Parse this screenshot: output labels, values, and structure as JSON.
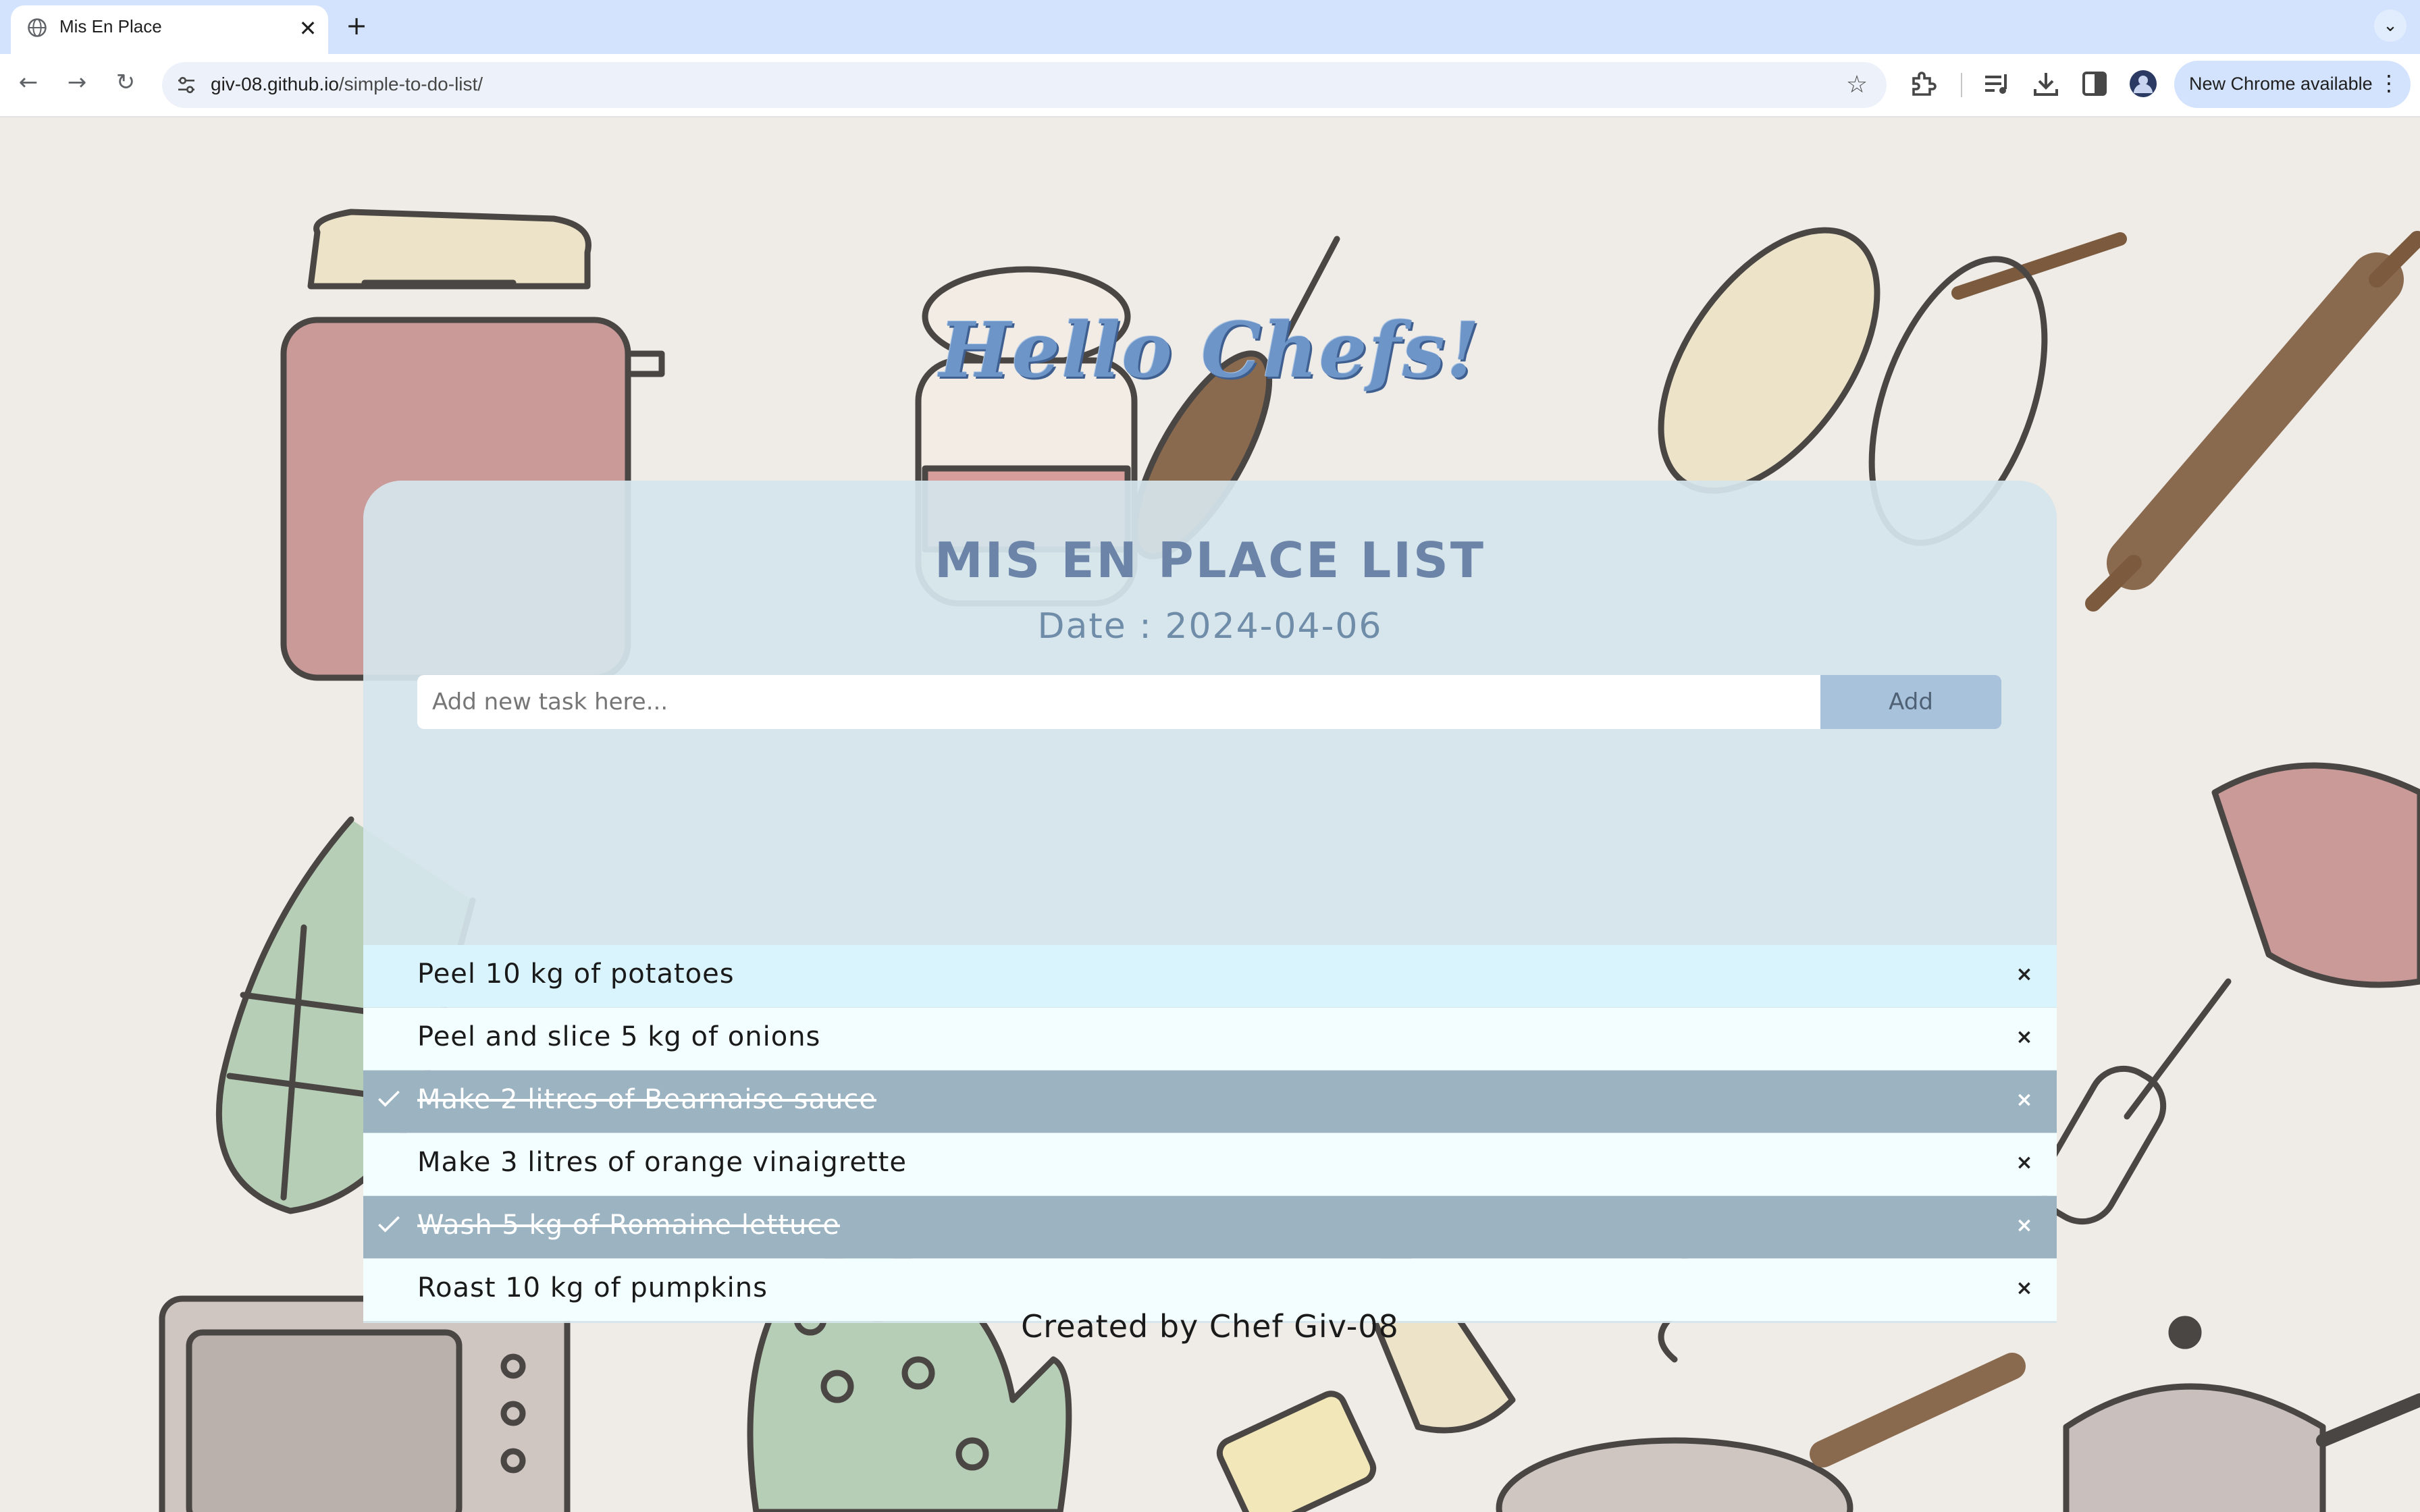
{
  "browser": {
    "tab_title": "Mis En Place",
    "url_host": "giv-08.github.io",
    "url_path": "/simple-to-do-list/",
    "update_label": "New Chrome available"
  },
  "page": {
    "hero_title": "Hello Chefs!",
    "list_title": "MIS EN PLACE LIST",
    "date_text": "Date : 2024-04-06",
    "input_placeholder": "Add new task here...",
    "add_label": "Add",
    "footer": "Created by Chef Giv-08",
    "tasks": [
      {
        "text": "Peel 10 kg of potatoes",
        "done": false,
        "highlighted": true
      },
      {
        "text": "Peel and slice 5 kg of onions",
        "done": false,
        "highlighted": false
      },
      {
        "text": "Make 2 litres of Bearnaise sauce",
        "done": true,
        "highlighted": false
      },
      {
        "text": "Make 3 litres of orange vinaigrette",
        "done": false,
        "highlighted": false
      },
      {
        "text": "Wash 5 kg of Romaine lettuce",
        "done": true,
        "highlighted": false
      },
      {
        "text": "Roast 10 kg of pumpkins",
        "done": false,
        "highlighted": false
      }
    ],
    "close_glyph": "×"
  },
  "colors": {
    "tabbar": "#d3e3fd",
    "card": "#d5e5ec",
    "done_row": "#9cb3c1",
    "highlight_row": "#d9f4fd",
    "add_button": "#a9c2dc",
    "title_blue": "#6d95c8"
  },
  "icons": [
    "globe-icon",
    "close-icon",
    "plus-icon",
    "chevron-down-icon",
    "back-arrow-icon",
    "forward-arrow-icon",
    "reload-icon",
    "site-info-icon",
    "star-icon",
    "extensions-icon",
    "media-controls-icon",
    "download-icon",
    "side-panel-icon",
    "profile-avatar",
    "more-vert-icon",
    "check-icon"
  ]
}
